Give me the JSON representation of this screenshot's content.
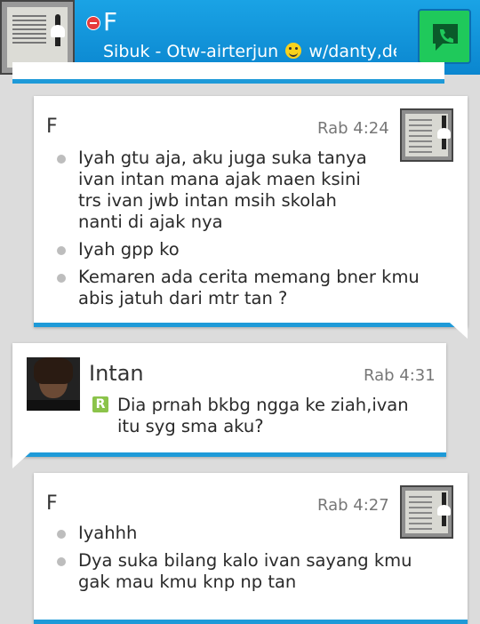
{
  "header": {
    "contact_name": "F",
    "status_text": "Sibuk - Otw-airterjun",
    "status_suffix": "w/danty,de...",
    "status_icon": "smiley-emoji",
    "availability": "busy",
    "call_icon": "phone-chat-icon"
  },
  "messages": [
    {
      "sender": "F",
      "time": "Rab 4:24",
      "lines": [
        "Iyah gtu aja, aku juga suka tanya ivan intan mana ajak maen ksini trs ivan jwb intan msih skolah nanti di ajak nya",
        "Iyah gpp ko",
        "Kemaren ada cerita memang bner kmu abis jatuh dari mtr tan ?"
      ]
    },
    {
      "sender": "Intan",
      "time": "Rab 4:31",
      "badge": "R",
      "lines": [
        "Dia prnah bkbg ngga ke ziah,ivan itu syg sma aku?"
      ]
    },
    {
      "sender": "F",
      "time": "Rab 4:27",
      "lines": [
        "Iyahhh",
        "Dya suka bilang kalo ivan sayang kmu gak mau kmu knp np tan"
      ]
    }
  ],
  "colors": {
    "header_blue": "#0b86cf",
    "accent_blue": "#1e9ad8",
    "call_green": "#1fc95b",
    "busy_red": "#e63b3b",
    "read_badge_green": "#8bc34a"
  }
}
